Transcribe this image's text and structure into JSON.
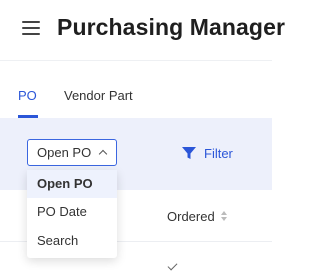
{
  "header": {
    "title": "Purchasing Manager",
    "menu_icon": "hamburger-menu-icon"
  },
  "tabs": [
    {
      "label": "PO",
      "active": true
    },
    {
      "label": "Vendor Part",
      "active": false
    }
  ],
  "toolbar": {
    "select": {
      "value": "Open PO",
      "icon": "chevron-up-icon"
    },
    "filter": {
      "label": "Filter",
      "icon": "filter-funnel-icon"
    }
  },
  "dropdown": {
    "options": [
      {
        "label": "Open PO",
        "selected": true
      },
      {
        "label": "PO Date",
        "selected": false
      },
      {
        "label": "Search",
        "selected": false
      }
    ]
  },
  "table": {
    "columns": [
      {
        "label": "Ordered",
        "sort_icon": "sort-icon"
      }
    ],
    "row_icon": "check-icon"
  },
  "colors": {
    "accent": "#2b56d8",
    "toolbar_bg": "#edf0fb",
    "selected_option_bg": "#eef2fd",
    "title_text": "#1f1f1f"
  }
}
